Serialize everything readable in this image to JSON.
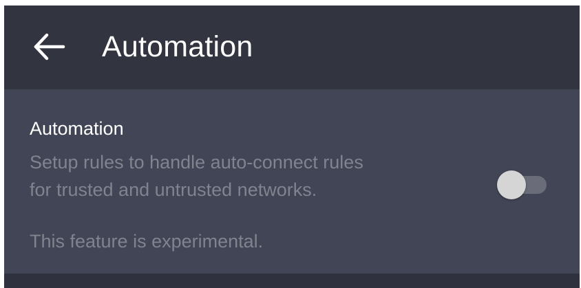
{
  "toolbar": {
    "back_icon": "arrow-left-icon",
    "title": "Automation"
  },
  "setting": {
    "title": "Automation",
    "description_line1": "Setup rules to handle auto-connect rules",
    "description_line2": "for trusted and untrusted networks.",
    "note": "This feature is experimental.",
    "toggle_on": false
  },
  "colors": {
    "toolbar_bg": "#323440",
    "row_bg": "#414555",
    "primary_text": "#ffffff",
    "secondary_text": "#80848f",
    "toggle_thumb": "#d5d5d5",
    "toggle_track": "#6a6d79"
  }
}
